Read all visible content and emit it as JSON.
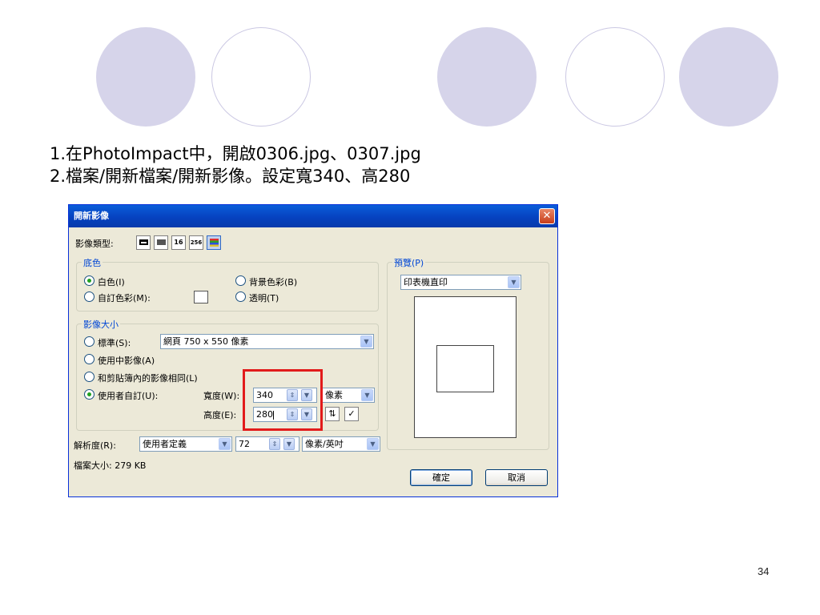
{
  "instructions": {
    "line1": "1.在PhotoImpact中，開啟0306.jpg、0307.jpg",
    "line2": "2.檔案/開新檔案/開新影像。設定寬340、高280"
  },
  "dialog": {
    "title": "開新影像",
    "image_type_label": "影像類型:",
    "image_type_buttons": [
      "",
      "",
      "16",
      "256",
      ""
    ],
    "background_group": {
      "title": "底色",
      "white": "白色(I)",
      "background_color": "背景色彩(B)",
      "custom_color": "自訂色彩(M):",
      "transparent": "透明(T)"
    },
    "size_group": {
      "title": "影像大小",
      "standard": "標準(S):",
      "standard_value": "網頁 750 x 550 像素",
      "in_use": "使用中影像(A)",
      "clipboard": "和剪貼簿內的影像相同(L)",
      "user_defined": "使用者自訂(U):",
      "width_label": "寬度(W):",
      "width_value": "340",
      "height_label": "高度(E):",
      "height_value": "280",
      "unit": "像素"
    },
    "resolution": {
      "label": "解析度(R):",
      "mode": "使用者定義",
      "value": "72",
      "unit": "像素/英吋"
    },
    "file_size": "檔案大小:  279 KB",
    "preview": {
      "title": "預覽(P)",
      "mode": "印表機直印"
    },
    "ok_button": "確定",
    "cancel_button": "取消"
  },
  "page_number": "34",
  "colors": {
    "accent_circle": "#d6d4ea",
    "highlight": "#e21b1b",
    "dialog_bg": "#ece9d8",
    "titlebar": "#0642c0"
  }
}
